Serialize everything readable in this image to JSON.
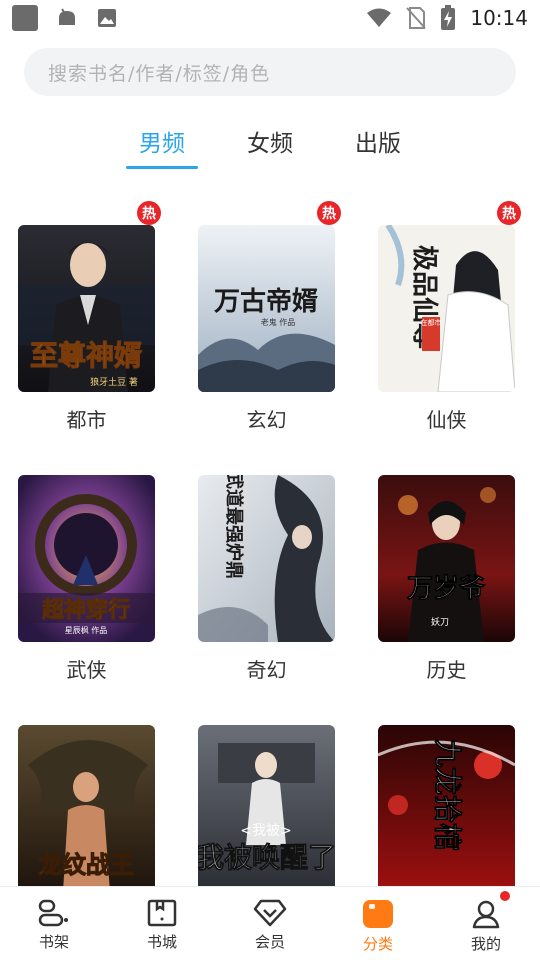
{
  "status_bar": {
    "time": "10:14",
    "left_icons": [
      "app-square-icon",
      "android-icon",
      "image-icon"
    ],
    "right_icons": [
      "wifi-icon",
      "no-sim-icon",
      "battery-charging-icon"
    ]
  },
  "search": {
    "placeholder": "搜索书名/作者/标签/角色"
  },
  "tabs": [
    {
      "label": "男频",
      "active": true
    },
    {
      "label": "女频",
      "active": false
    },
    {
      "label": "出版",
      "active": false
    }
  ],
  "hot_badge": "热",
  "categories": [
    {
      "label": "都市",
      "hot": true,
      "cover_title": "至尊神婿",
      "cover_sub": "狼牙土豆 著"
    },
    {
      "label": "玄幻",
      "hot": true,
      "cover_title": "万古帝婿",
      "cover_sub": "老鬼 作品"
    },
    {
      "label": "仙侠",
      "hot": true,
      "cover_title": "极品仙尊",
      "cover_sub": "在都市"
    },
    {
      "label": "武侠",
      "hot": false,
      "cover_title": "超神穿行",
      "cover_sub": "星辰枫 作品"
    },
    {
      "label": "奇幻",
      "hot": false,
      "cover_title": "武道最强炉鼎",
      "cover_sub": ""
    },
    {
      "label": "历史",
      "hot": false,
      "cover_title": "万岁爷",
      "cover_sub": "妖刀"
    },
    {
      "label": "",
      "hot": false,
      "cover_title": "龙纹战王",
      "cover_sub": ""
    },
    {
      "label": "",
      "hot": false,
      "cover_title": "我被唤醒了",
      "cover_sub": ""
    },
    {
      "label": "",
      "hot": false,
      "cover_title": "九龙拾棺",
      "cover_sub": ""
    }
  ],
  "bottom_nav": [
    {
      "label": "书架",
      "icon": "bookshelf-icon",
      "active": false
    },
    {
      "label": "书城",
      "icon": "bookstore-icon",
      "active": false
    },
    {
      "label": "会员",
      "icon": "diamond-icon",
      "active": false
    },
    {
      "label": "分类",
      "icon": "category-icon",
      "active": true
    },
    {
      "label": "我的",
      "icon": "profile-icon",
      "active": false,
      "dot": true
    }
  ],
  "colors": {
    "accent_blue": "#2aa5e9",
    "accent_orange": "#ff7a12",
    "hot_red": "#e8262a"
  }
}
